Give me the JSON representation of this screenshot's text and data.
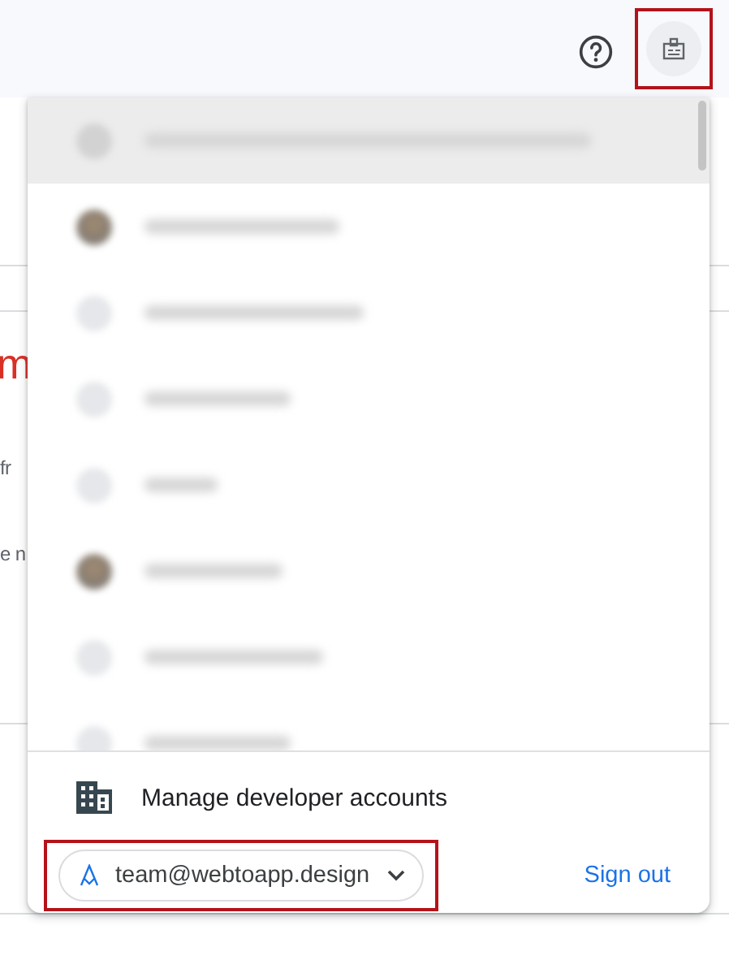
{
  "background_page": {
    "heading_fragment": "m",
    "text_fragments": [
      "fr",
      "e n"
    ]
  },
  "account_menu": {
    "accounts": [
      {
        "selected": true,
        "kind": "plain"
      },
      {
        "selected": false,
        "kind": "photo"
      },
      {
        "selected": false,
        "kind": "plain"
      },
      {
        "selected": false,
        "kind": "plain"
      },
      {
        "selected": false,
        "kind": "plain"
      },
      {
        "selected": false,
        "kind": "photo"
      },
      {
        "selected": false,
        "kind": "plain"
      },
      {
        "selected": false,
        "kind": "plain"
      }
    ],
    "manage_label": "Manage developer accounts",
    "current_account": "team@webtoapp.design",
    "sign_out": "Sign out"
  }
}
